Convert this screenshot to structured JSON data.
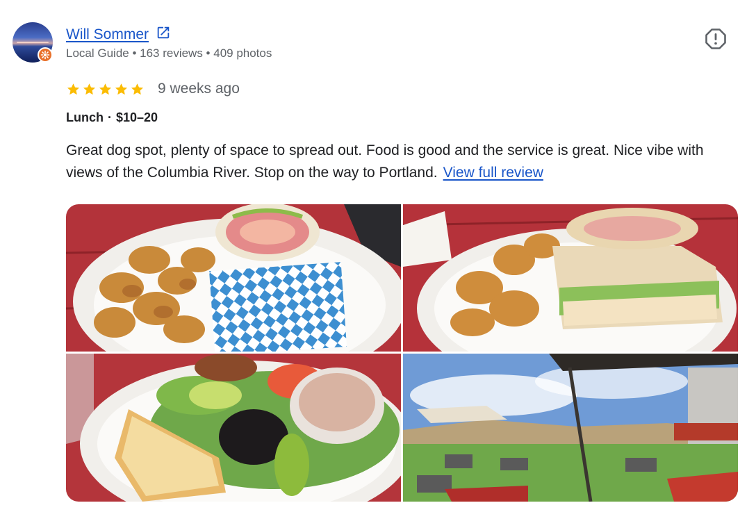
{
  "reviewer": {
    "name": "Will Sommer",
    "meta": "Local Guide • 163 reviews • 409 photos"
  },
  "review": {
    "rating": 5,
    "rating_max": 5,
    "time_ago": "9 weeks ago",
    "meal": "Lunch",
    "separator": "·",
    "price": "$10–20",
    "text": "Great dog spot, plenty of space to spread out. Food is good and the service is great. Nice vibe with views of the Columbia River. Stop on the way to Portland.",
    "view_full_label": "View full review"
  },
  "colors": {
    "link": "#1a56c9",
    "star": "#fbbc04",
    "badge": "#e8702a",
    "muted": "#5f6368"
  },
  "icons": {
    "external_link": "open-in-new-icon",
    "report": "report-flag-icon",
    "star": "star-icon",
    "local_guide": "local-guide-badge-icon"
  }
}
